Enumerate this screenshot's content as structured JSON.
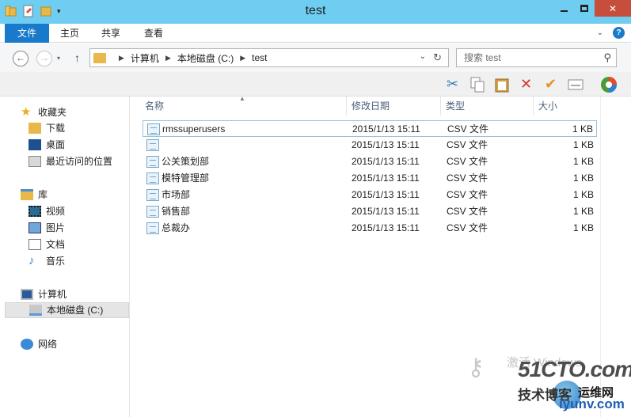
{
  "window": {
    "title": "test",
    "buttons": {
      "minimize": "—",
      "maximize": "□",
      "close": "✕"
    }
  },
  "ribbon": {
    "tabs": [
      "文件",
      "主页",
      "共享",
      "查看"
    ],
    "help_label": "?"
  },
  "address_bar": {
    "breadcrumb": [
      "计算机",
      "本地磁盘 (C:)",
      "test"
    ]
  },
  "search": {
    "placeholder": "搜索 test"
  },
  "toolbar": {
    "icons": [
      "scissors-icon",
      "copy-icon",
      "paste-icon",
      "delete-icon",
      "check-icon",
      "rename-icon",
      "color-wheel-icon"
    ]
  },
  "sidebar": {
    "favorites": {
      "label": "收藏夹",
      "items": [
        "下载",
        "桌面",
        "最近访问的位置"
      ]
    },
    "libraries": {
      "label": "库",
      "items": [
        "视频",
        "图片",
        "文档",
        "音乐"
      ]
    },
    "computer": {
      "label": "计算机",
      "items": [
        "本地磁盘 (C:)"
      ]
    },
    "network": {
      "label": "网络"
    }
  },
  "columns": {
    "name": "名称",
    "date": "修改日期",
    "type": "类型",
    "size": "大小"
  },
  "files": [
    {
      "name": "rmssuperusers",
      "date": "2015/1/13 15:11",
      "type": "CSV 文件",
      "size": "1 KB"
    },
    {
      "name": "",
      "date": "2015/1/13 15:11",
      "type": "CSV 文件",
      "size": "1 KB"
    },
    {
      "name": "公关策划部",
      "date": "2015/1/13 15:11",
      "type": "CSV 文件",
      "size": "1 KB"
    },
    {
      "name": "模特管理部",
      "date": "2015/1/13 15:11",
      "type": "CSV 文件",
      "size": "1 KB"
    },
    {
      "name": "市场部",
      "date": "2015/1/13 15:11",
      "type": "CSV 文件",
      "size": "1 KB"
    },
    {
      "name": "销售部",
      "date": "2015/1/13 15:11",
      "type": "CSV 文件",
      "size": "1 KB"
    },
    {
      "name": "总裁办",
      "date": "2015/1/13 15:11",
      "type": "CSV 文件",
      "size": "1 KB"
    }
  ],
  "watermark": {
    "activation": "激活 Windows",
    "brand": "51CTO.com",
    "tech": "技术博客",
    "ops": "运维网",
    "site": "iyunv.com"
  },
  "colors": {
    "titlebar": "#6ecdf0",
    "file_tab": "#1979ca",
    "close_button": "#c74d3d"
  }
}
